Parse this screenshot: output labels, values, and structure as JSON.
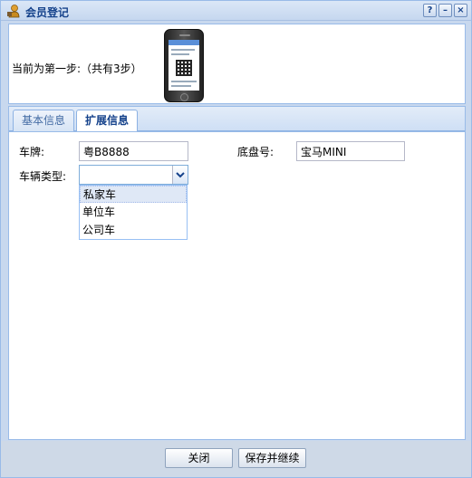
{
  "window": {
    "title": "会员登记",
    "tools": {
      "help": "?",
      "minimize": "–",
      "close": "×"
    }
  },
  "step": {
    "text": "当前为第一步:（共有3步）"
  },
  "tabs": [
    {
      "label": "基本信息",
      "active": false
    },
    {
      "label": "扩展信息",
      "active": true
    }
  ],
  "form": {
    "plate_label": "车牌:",
    "plate_value": "粤B8888",
    "chassis_label": "底盘号:",
    "chassis_value": "宝马MINI",
    "vehicle_type_label": "车辆类型:",
    "vehicle_type_value": "",
    "vehicle_type_options": [
      "私家车",
      "单位车",
      "公司车"
    ]
  },
  "buttons": {
    "close": "关闭",
    "save_continue": "保存并继续"
  },
  "colors": {
    "title": "#15428b",
    "border": "#99bbe8",
    "panel_bg": "#c8d8ee"
  }
}
